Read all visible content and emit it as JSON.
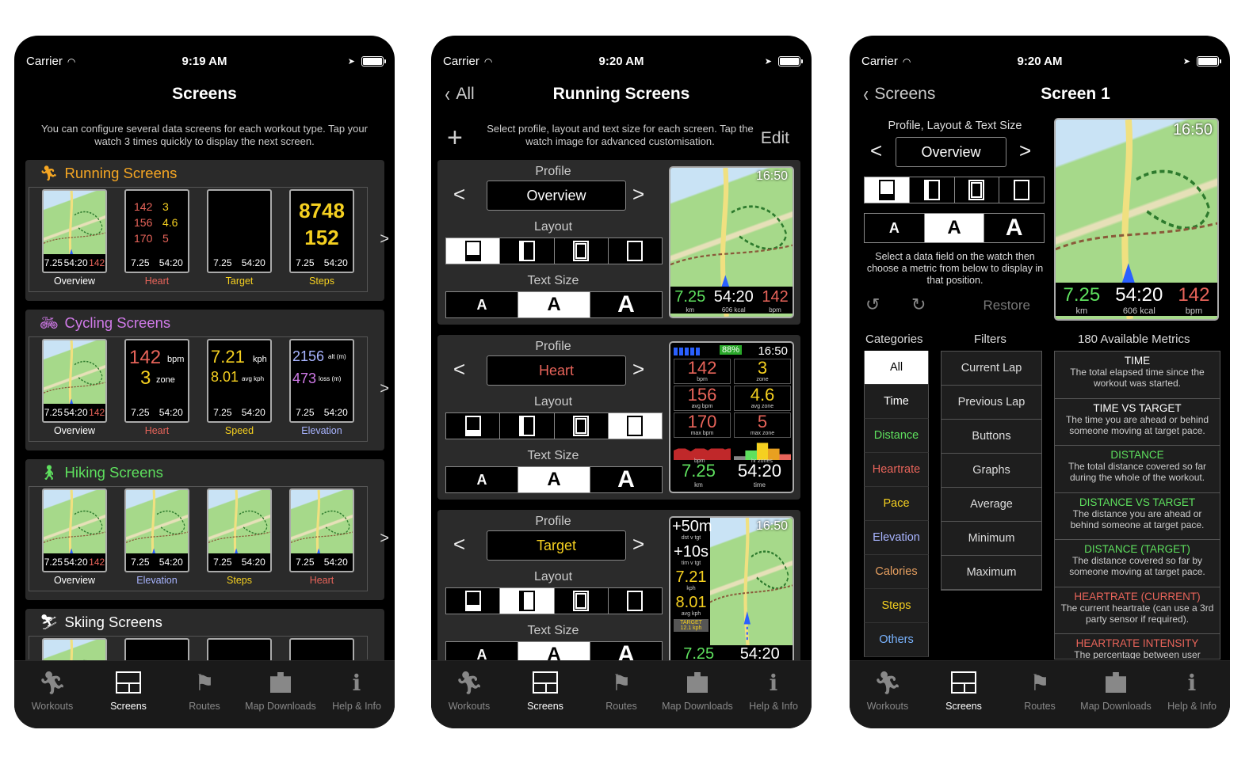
{
  "status": {
    "carrier": "Carrier",
    "time1": "9:19 AM",
    "time2": "9:20 AM",
    "time3": "9:20 AM"
  },
  "tabs": [
    "Workouts",
    "Screens",
    "Routes",
    "Map Downloads",
    "Help & Info"
  ],
  "phone1": {
    "title": "Screens",
    "intro": "You can configure several data screens for each workout type. Tap your watch 3 times quickly to display the next screen.",
    "sections": [
      {
        "title": "Running Screens",
        "color": "#f5a623",
        "labels": [
          "Overview",
          "Heart",
          "Target",
          "Steps"
        ],
        "label_colors": [
          "#ffffff",
          "#e8645a",
          "#f5d020",
          "#f5d020"
        ]
      },
      {
        "title": "Cycling Screens",
        "color": "#d07ae8",
        "labels": [
          "Overview",
          "Heart",
          "Speed",
          "Elevation"
        ],
        "label_colors": [
          "#ffffff",
          "#e8645a",
          "#f5d020",
          "#a8b4ff"
        ]
      },
      {
        "title": "Hiking Screens",
        "color": "#5ee05e",
        "labels": [
          "Overview",
          "Elevation",
          "Steps",
          "Heart"
        ],
        "label_colors": [
          "#ffffff",
          "#a8b4ff",
          "#f5d020",
          "#e8645a"
        ]
      },
      {
        "title": "Skiing Screens",
        "color": "#ffffff",
        "labels": [],
        "label_colors": []
      }
    ],
    "thumbs": {
      "steps_value": "8748",
      "cadence_value": "152",
      "dist": "7.25",
      "time": "54:20",
      "hr": "142",
      "hr2": "142",
      "hr_unit": "bpm",
      "zone": "3",
      "zone_unit": "zone",
      "speed": "7.21",
      "speed_unit": "kph",
      "avg_speed": "8.01",
      "avg_speed_unit": "avg kph",
      "elev": "2156",
      "elev_unit": "alt (m)",
      "loss": "473",
      "loss_unit": "loss (m)",
      "heart_grid": [
        "142",
        "3",
        "156",
        "4.6",
        "170",
        "5"
      ]
    }
  },
  "phone2": {
    "back": "All",
    "title": "Running Screens",
    "intro": "Select profile, layout and text size for each screen. Tap the watch image for advanced customisation.",
    "edit": "Edit",
    "labels": {
      "profile": "Profile",
      "layout": "Layout",
      "text_size": "Text Size"
    },
    "cards": [
      {
        "profile": "Overview",
        "profile_color": "#ffffff",
        "layout_selected": 0,
        "text_selected": 1
      },
      {
        "profile": "Heart",
        "profile_color": "#e8645a",
        "layout_selected": 3,
        "text_selected": 1
      },
      {
        "profile": "Target",
        "profile_color": "#f5d020",
        "layout_selected": 1,
        "text_selected": 1
      }
    ],
    "watch1": {
      "clock": "16:50",
      "dist": "7.25",
      "dist_u": "km",
      "time": "54:20",
      "time_u": "606 kcal",
      "hr": "142",
      "hr_u": "bpm"
    },
    "watch2": {
      "clock": "16:50",
      "battery": "88%",
      "cells": [
        {
          "v": "142",
          "u": "bpm",
          "c": "#e8645a"
        },
        {
          "v": "3",
          "u": "zone",
          "c": "#f5d020"
        },
        {
          "v": "156",
          "u": "avg bpm",
          "c": "#e8645a"
        },
        {
          "v": "4.6",
          "u": "avg zone",
          "c": "#f5d020"
        },
        {
          "v": "170",
          "u": "max bpm",
          "c": "#e8645a"
        },
        {
          "v": "5",
          "u": "max zone",
          "c": "#e8645a"
        }
      ],
      "chart1_u": "bpm",
      "chart2_u": "hr zones",
      "dist": "7.25",
      "dist_u": "km",
      "time": "54:20",
      "time_u": "time"
    },
    "watch3": {
      "clock": "16:50",
      "rows": [
        {
          "v": "+50m",
          "u": "dst v tgt"
        },
        {
          "v": "+10s",
          "u": "tim v tgt"
        },
        {
          "v": "7.21",
          "u": "kph"
        },
        {
          "v": "8.01",
          "u": "avg kph"
        }
      ],
      "target": "TARGET 12.1 kph",
      "dist": "7.25",
      "time": "54:20"
    }
  },
  "phone3": {
    "back": "Screens",
    "title": "Screen 1",
    "plt_label": "Profile, Layout & Text Size",
    "profile": "Overview",
    "help": "Select a data field on the watch then choose a metric from below to display in that position.",
    "restore": "Restore",
    "col_categories": "Categories",
    "col_filters": "Filters",
    "col_metrics": "180 Available Metrics",
    "categories": [
      {
        "t": "All",
        "c": "#000000"
      },
      {
        "t": "Time",
        "c": "#ffffff"
      },
      {
        "t": "Distance",
        "c": "#5ee05e"
      },
      {
        "t": "Heartrate",
        "c": "#e8645a"
      },
      {
        "t": "Pace",
        "c": "#f5d020"
      },
      {
        "t": "Elevation",
        "c": "#a8b4ff"
      },
      {
        "t": "Calories",
        "c": "#e8a060"
      },
      {
        "t": "Steps",
        "c": "#f5d020"
      },
      {
        "t": "Others",
        "c": "#7ab4ff"
      }
    ],
    "filters": [
      "Current Lap",
      "Previous Lap",
      "Buttons",
      "Graphs",
      "Average",
      "Minimum",
      "Maximum"
    ],
    "metrics": [
      {
        "t": "TIME",
        "d": "The total elapsed time since the workout was started.",
        "c": "#ffffff"
      },
      {
        "t": "TIME VS TARGET",
        "d": "The time you are ahead or behind someone moving at target pace.",
        "c": "#ffffff"
      },
      {
        "t": "DISTANCE",
        "d": "The total distance covered so far during the whole of the workout.",
        "c": "#5ee05e"
      },
      {
        "t": "DISTANCE VS TARGET",
        "d": "The distance you are ahead or behind someone at target pace.",
        "c": "#5ee05e"
      },
      {
        "t": "DISTANCE (TARGET)",
        "d": "The distance covered so far by someone moving at target pace.",
        "c": "#5ee05e"
      },
      {
        "t": "HEARTRATE (CURRENT)",
        "d": "The current heartrate (can use a 3rd party sensor if required).",
        "c": "#e8645a"
      },
      {
        "t": "HEARTRATE INTENSITY",
        "d": "The percentage between user",
        "c": "#e8645a"
      }
    ],
    "watch": {
      "clock": "16:50",
      "dist": "7.25",
      "dist_u": "km",
      "time": "54:20",
      "time_u": "606 kcal",
      "hr": "142",
      "hr_u": "bpm"
    }
  }
}
